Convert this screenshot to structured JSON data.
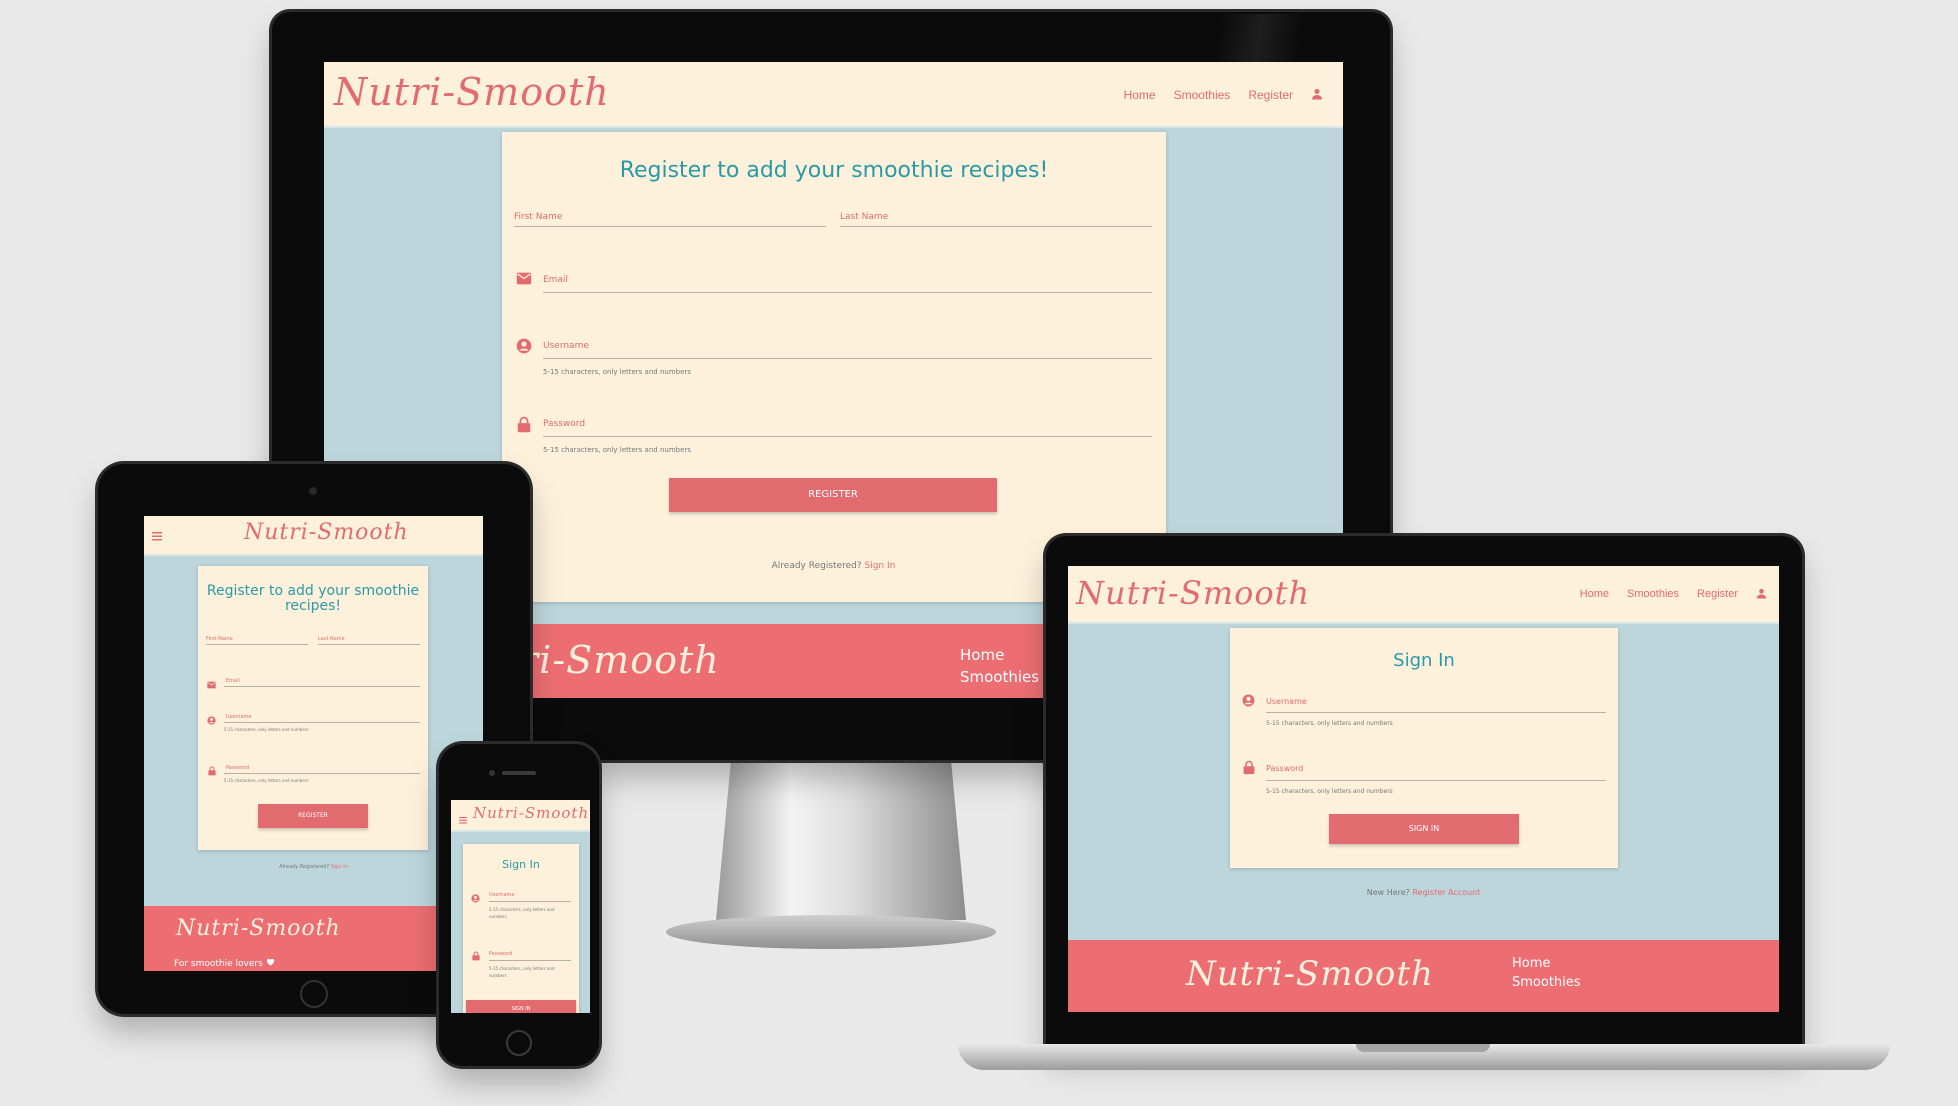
{
  "brand": "Nutri-Smooth",
  "nav": {
    "home": "Home",
    "smoothies": "Smoothies",
    "register": "Register"
  },
  "register": {
    "title": "Register to add your smoothie recipes!",
    "title_line1": "Register to add your smoothie",
    "title_line2": "recipes!",
    "first_name": "First Name",
    "last_name": "Last Name",
    "email": "Email",
    "username": "Username",
    "password": "Password",
    "help": "5-15 characters, only letters and numbers",
    "button": "REGISTER",
    "already": "Already Registered?",
    "signin_link": "Sign In"
  },
  "signin": {
    "title": "Sign In",
    "username": "Username",
    "password": "Password",
    "help": "5-15 characters, only letters and numbers",
    "button": "SIGN IN",
    "new_here": "New Here?",
    "register_link": "Register Account"
  },
  "footer": {
    "home": "Home",
    "smoothies": "Smoothies",
    "tagline": "For smoothie lovers"
  },
  "icons": {
    "email": "email-icon",
    "user": "account-circle-icon",
    "lock": "lock-icon",
    "person": "person-icon",
    "menu": "hamburger-menu-icon",
    "heart": "heart-icon"
  },
  "colors": {
    "accent": "#e26b70",
    "teal": "#2a9aa6",
    "cream": "#fdf1dc",
    "body_bg": "#bcd6dc",
    "footer": "#ec6e73"
  }
}
